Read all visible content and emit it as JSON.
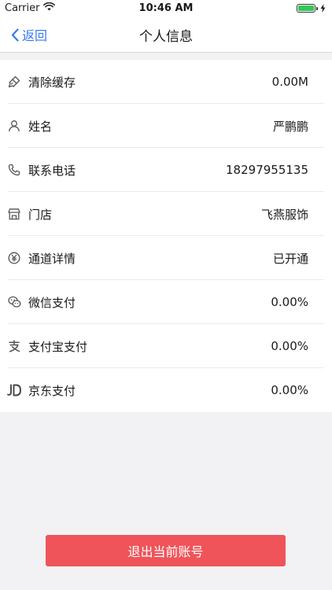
{
  "status_bar": {
    "carrier": "Carrier",
    "time": "10:46 AM"
  },
  "nav": {
    "back_label": "返回",
    "title": "个人信息"
  },
  "rows": [
    {
      "icon": "brush-icon",
      "label": "清除缓存",
      "value": "0.00M"
    },
    {
      "icon": "person-icon",
      "label": "姓名",
      "value": "严鹏鹏"
    },
    {
      "icon": "phone-icon",
      "label": "联系电话",
      "value": "18297955135"
    },
    {
      "icon": "store-icon",
      "label": "门店",
      "value": "飞燕服饰"
    },
    {
      "icon": "yen-circle-icon",
      "label": "通道详情",
      "value": "已开通"
    },
    {
      "icon": "wechat-pay-icon",
      "label": "微信支付",
      "value": "0.00%"
    },
    {
      "icon": "alipay-icon",
      "label": "支付宝支付",
      "value": "0.00%"
    },
    {
      "icon": "jd-icon",
      "label": "京东支付",
      "value": "0.00%"
    }
  ],
  "logout_label": "退出当前账号",
  "colors": {
    "accent": "#3579f6",
    "logout": "#ee5459",
    "background": "#f2f2f4",
    "battery": "#33c759"
  }
}
